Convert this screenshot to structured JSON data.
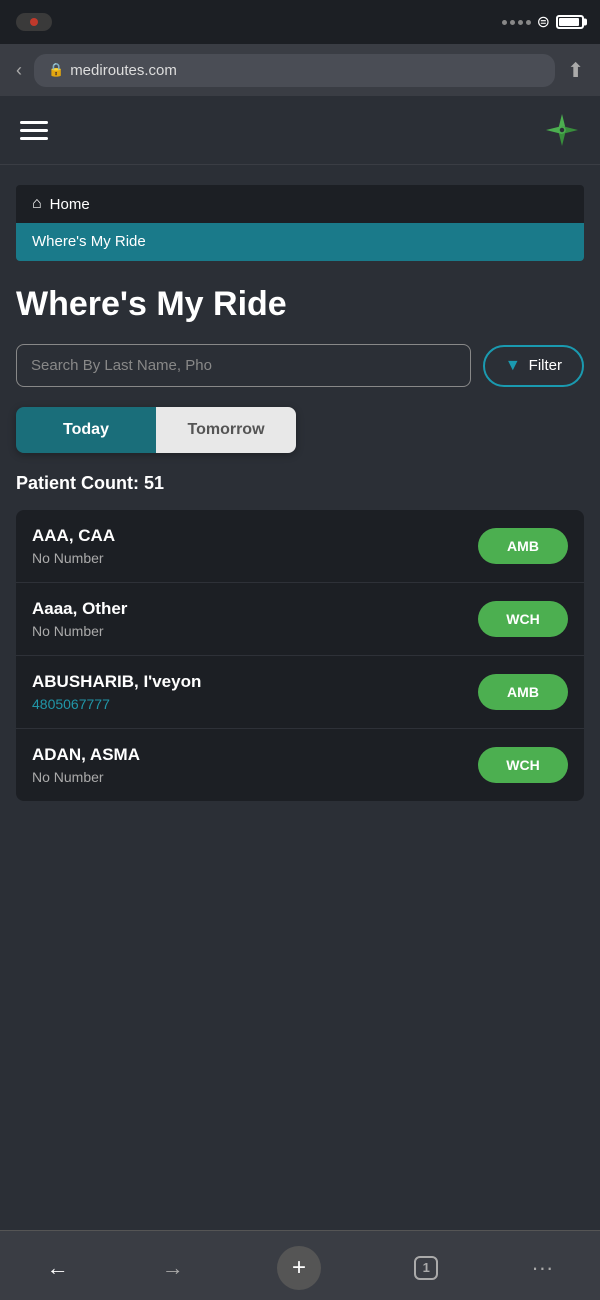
{
  "statusBar": {
    "url": "mediroutes.com"
  },
  "nav": {
    "logoAlt": "MediRoutes compass logo"
  },
  "breadcrumb": {
    "home": "Home",
    "active": "Where's My Ride"
  },
  "page": {
    "title": "Where's My Ride",
    "searchPlaceholder": "Search By Last Name, Pho",
    "filterLabel": "Filter",
    "patientCount": "Patient Count: 51"
  },
  "tabs": {
    "today": "Today",
    "tomorrow": "Tomorrow"
  },
  "patients": [
    {
      "name": "AAA, CAA",
      "contact": "No Number",
      "badge": "AMB",
      "isLink": false
    },
    {
      "name": "Aaaa, Other",
      "contact": "No Number",
      "badge": "WCH",
      "isLink": false
    },
    {
      "name": "ABUSHARIB, I'veyon",
      "contact": "4805067777",
      "badge": "AMB",
      "isLink": true
    },
    {
      "name": "ADAN, ASMA",
      "contact": "No Number",
      "badge": "WCH",
      "isLink": false
    }
  ],
  "bottomNav": {
    "back": "←",
    "forward": "→",
    "add": "+",
    "tabCount": "1",
    "more": "···"
  }
}
